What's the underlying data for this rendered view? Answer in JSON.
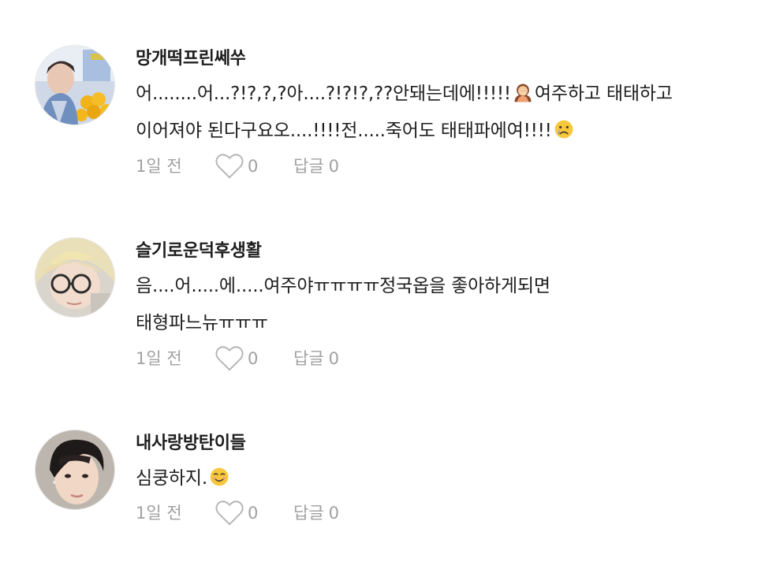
{
  "comments": [
    {
      "username": "망개떡프린쎄쑤",
      "line1_a": "어........어...?!?,?,?아....?!?!?,??안돼는데에!!!!!",
      "line1_b": "여주하고 태태하고",
      "line2_a": "이어져야 된다구요오....!!!!전.....죽어도 태태파에여!!!!",
      "emoji1": "woman-facepalming-icon",
      "emoji2": "crying-face-icon",
      "time": "1일 전",
      "likes": "0",
      "reply_label": "답글",
      "reply_count": "0"
    },
    {
      "username": "슬기로운덕후생활",
      "line1": "음....어.....에.....여주야ㅠㅠㅠㅠ정국옵을 좋아하게되면",
      "line2": "태형파느뉴ㅠㅠㅠ",
      "time": "1일 전",
      "likes": "0",
      "reply_label": "답글",
      "reply_count": "0"
    },
    {
      "username": "내사랑방탄이들",
      "line1": "심쿵하지.",
      "emoji1": "smiling-face-icon",
      "time": "1일 전",
      "likes": "0",
      "reply_label": "답글",
      "reply_count": "0"
    }
  ],
  "colors": {
    "text": "#1e1e1e",
    "meta": "#a0a0a0",
    "background": "#ffffff"
  }
}
